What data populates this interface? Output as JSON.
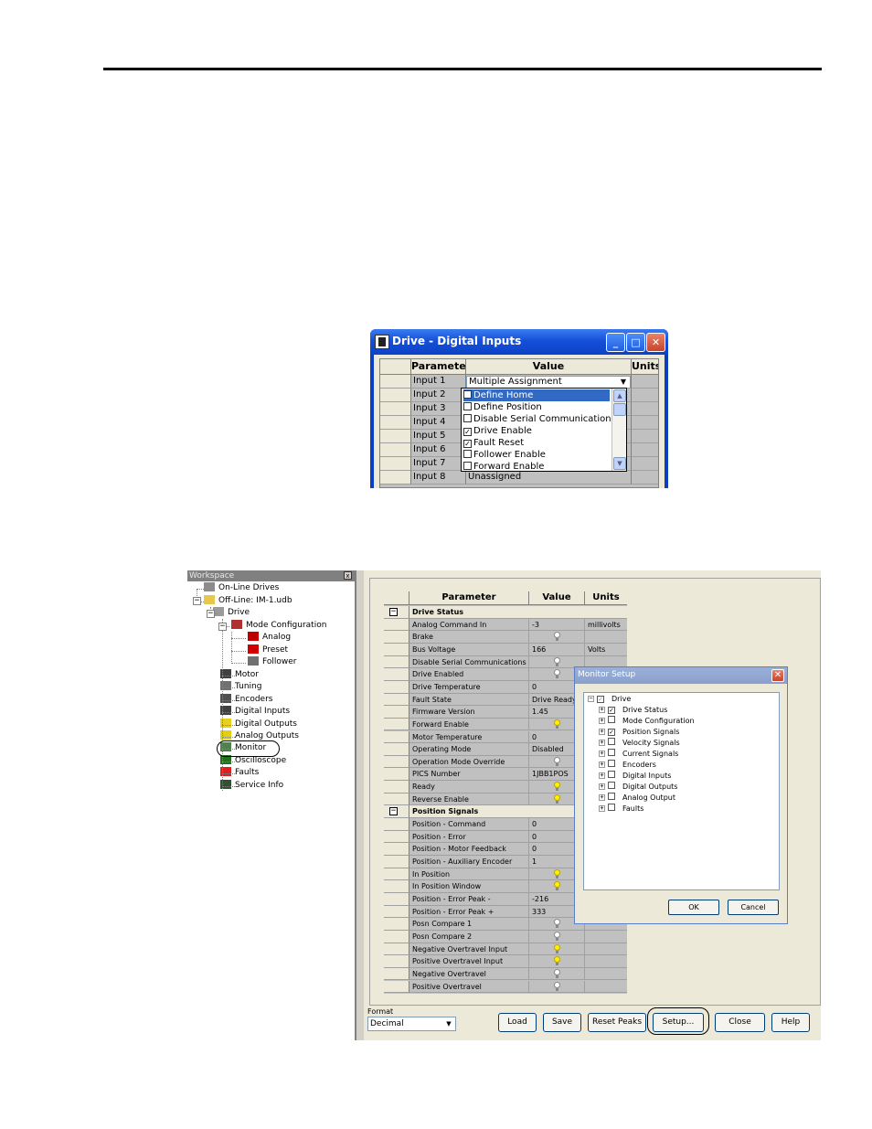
{
  "digital_inputs_window": {
    "title": "Drive - Digital Inputs",
    "columns": [
      "Parameter",
      "Value",
      "Units"
    ],
    "rows": [
      {
        "parameter": "Input 1",
        "value": "Multiple Assignment"
      },
      {
        "parameter": "Input 2",
        "value": ""
      },
      {
        "parameter": "Input 3",
        "value": ""
      },
      {
        "parameter": "Input 4",
        "value": ""
      },
      {
        "parameter": "Input 5",
        "value": ""
      },
      {
        "parameter": "Input 6",
        "value": ""
      },
      {
        "parameter": "Input 7",
        "value": ""
      },
      {
        "parameter": "Input 8",
        "value": "Unassigned"
      }
    ],
    "dropdown_items": [
      {
        "label": "Define Home",
        "checked": false,
        "selected": true
      },
      {
        "label": "Define Position",
        "checked": false,
        "selected": false
      },
      {
        "label": "Disable Serial Communications",
        "checked": false,
        "selected": false
      },
      {
        "label": "Drive Enable",
        "checked": true,
        "selected": false
      },
      {
        "label": "Fault Reset",
        "checked": true,
        "selected": false
      },
      {
        "label": "Follower Enable",
        "checked": false,
        "selected": false
      },
      {
        "label": "Forward Enable",
        "checked": false,
        "selected": false
      }
    ]
  },
  "workspace": {
    "title": "Workspace",
    "tree": [
      {
        "label": "On-Line Drives",
        "icon": "network-icon"
      },
      {
        "label": "Off-Line: IM-1.udb",
        "icon": "folder-icon"
      },
      {
        "label": "Drive",
        "icon": "drive-icon"
      },
      {
        "label": "Mode Configuration",
        "icon": "mode-icon"
      },
      {
        "label": "Analog",
        "icon": "analog-icon"
      },
      {
        "label": "Preset",
        "icon": "preset-icon"
      },
      {
        "label": "Follower",
        "icon": "follower-icon"
      },
      {
        "label": "Motor",
        "icon": "motor-icon"
      },
      {
        "label": "Tuning",
        "icon": "tuning-icon"
      },
      {
        "label": "Encoders",
        "icon": "encoder-icon"
      },
      {
        "label": "Digital Inputs",
        "icon": "digital-input-icon"
      },
      {
        "label": "Digital Outputs",
        "icon": "digital-output-icon"
      },
      {
        "label": "Analog Outputs",
        "icon": "analog-output-icon"
      },
      {
        "label": "Monitor",
        "icon": "monitor-icon"
      },
      {
        "label": "Oscilloscope",
        "icon": "oscilloscope-icon"
      },
      {
        "label": "Faults",
        "icon": "fault-icon"
      },
      {
        "label": "Service Info",
        "icon": "service-icon"
      }
    ]
  },
  "monitor": {
    "columns": [
      "Parameter",
      "Value",
      "Units"
    ],
    "rows": [
      {
        "section": true,
        "parameter": "Drive Status"
      },
      {
        "parameter": "Analog Command In",
        "value": "-3",
        "units": "millivolts"
      },
      {
        "parameter": "Brake",
        "bulb": "off"
      },
      {
        "parameter": "Bus Voltage",
        "value": "166",
        "units": "Volts"
      },
      {
        "parameter": "Disable Serial Communications",
        "bulb": "off"
      },
      {
        "parameter": "Drive Enabled",
        "bulb": "off"
      },
      {
        "parameter": "Drive Temperature",
        "value": "0"
      },
      {
        "parameter": "Fault State",
        "value": "Drive Ready"
      },
      {
        "parameter": "Firmware Version",
        "value": "1.45"
      },
      {
        "parameter": "Forward Enable",
        "bulb": "on"
      },
      {
        "parameter": "Motor Temperature",
        "value": "0"
      },
      {
        "parameter": "Operating Mode",
        "value": "Disabled"
      },
      {
        "parameter": "Operation Mode Override",
        "bulb": "off"
      },
      {
        "parameter": "PICS Number",
        "value": "1JBB1POS"
      },
      {
        "parameter": "Ready",
        "bulb": "on"
      },
      {
        "parameter": "Reverse Enable",
        "bulb": "on"
      },
      {
        "section": true,
        "parameter": "Position Signals"
      },
      {
        "parameter": "Position - Command",
        "value": "0"
      },
      {
        "parameter": "Position - Error",
        "value": "0"
      },
      {
        "parameter": "Position - Motor Feedback",
        "value": "0"
      },
      {
        "parameter": "Position - Auxiliary Encoder",
        "value": "1"
      },
      {
        "parameter": "In Position",
        "bulb": "on"
      },
      {
        "parameter": "In Position Window",
        "bulb": "on"
      },
      {
        "parameter": "Position - Error Peak -",
        "value": "-216"
      },
      {
        "parameter": "Position - Error Peak +",
        "value": "333"
      },
      {
        "parameter": "Posn Compare 1",
        "bulb": "off"
      },
      {
        "parameter": "Posn Compare 2",
        "bulb": "off"
      },
      {
        "parameter": "Negative Overtravel Input",
        "bulb": "on"
      },
      {
        "parameter": "Positive Overtravel Input",
        "bulb": "on"
      },
      {
        "parameter": "Negative Overtravel",
        "bulb": "off"
      },
      {
        "parameter": "Positive Overtravel",
        "bulb": "off"
      }
    ],
    "format_label": "Format",
    "format_value": "Decimal",
    "buttons": {
      "load": "Load",
      "save": "Save",
      "reset_peaks": "Reset Peaks",
      "setup": "Setup...",
      "close": "Close",
      "help": "Help"
    }
  },
  "monitor_setup": {
    "title": "Monitor Setup",
    "root": {
      "label": "Drive",
      "checked": true
    },
    "items": [
      {
        "label": "Drive Status",
        "checked": true
      },
      {
        "label": "Mode Configuration",
        "checked": false
      },
      {
        "label": "Position Signals",
        "checked": true
      },
      {
        "label": "Velocity Signals",
        "checked": false
      },
      {
        "label": "Current Signals",
        "checked": false
      },
      {
        "label": "Encoders",
        "checked": false
      },
      {
        "label": "Digital Inputs",
        "checked": false
      },
      {
        "label": "Digital Outputs",
        "checked": false
      },
      {
        "label": "Analog Output",
        "checked": false
      },
      {
        "label": "Faults",
        "checked": false
      }
    ],
    "ok": "OK",
    "cancel": "Cancel"
  }
}
